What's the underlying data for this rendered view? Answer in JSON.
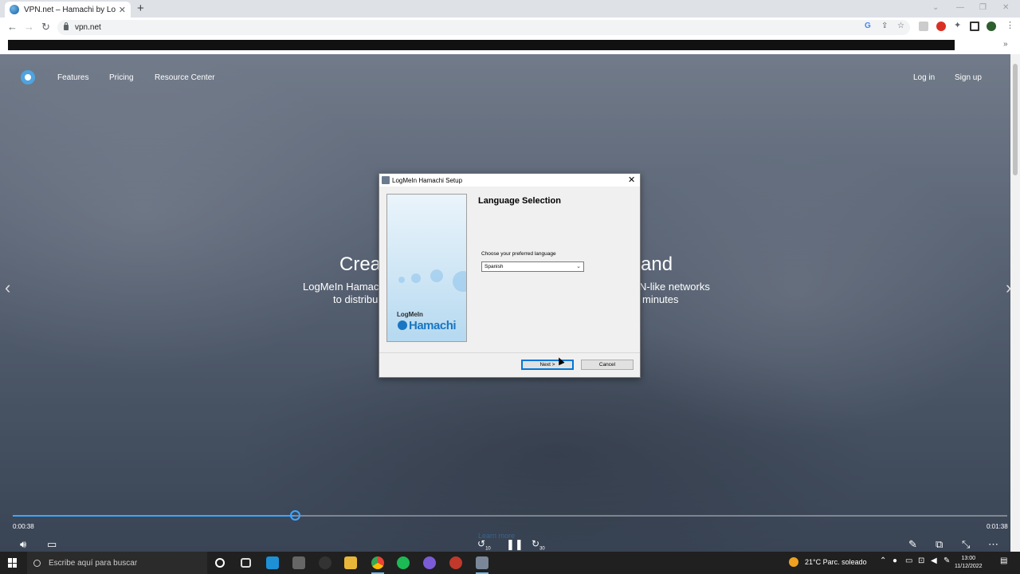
{
  "browser": {
    "tab_title": "VPN.net – Hamachi by LogMeIn",
    "tab_close": "✕",
    "new_tab": "+",
    "url": "vpn.net",
    "bookmarks_more": "»"
  },
  "site": {
    "nav": [
      "Features",
      "Pricing",
      "Resource Center"
    ],
    "login": "Log in",
    "signup": "Sign up",
    "hero_left": "Crea",
    "hero_right": "and",
    "sub_left_1": "LogMeIn Hamachi",
    "sub_left_2": "to distribu",
    "sub_right_1": "N-like networks",
    "sub_right_2": "minutes",
    "prev_arrow": "‹",
    "next_arrow": "›"
  },
  "dialog": {
    "title": "LogMeIn Hamachi Setup",
    "close": "✕",
    "heading": "Language Selection",
    "language_label": "Choose your preferred language",
    "selected_language": "Spanish",
    "brand_small": "LogMeIn",
    "brand_big": "Hamachi",
    "next_button": "Next >",
    "cancel_button": "Cancel"
  },
  "video": {
    "current_time": "0:00:38",
    "total_time": "0:01:38",
    "progress": 0.284,
    "rewind_label": "10",
    "forward_label": "30",
    "learn_more": "Learn more"
  },
  "taskbar": {
    "search_placeholder": "Escribe aquí para buscar",
    "temperature": "21°C",
    "weather": "Parc. soleado",
    "time": "13:00",
    "date": "11/12/2022"
  }
}
